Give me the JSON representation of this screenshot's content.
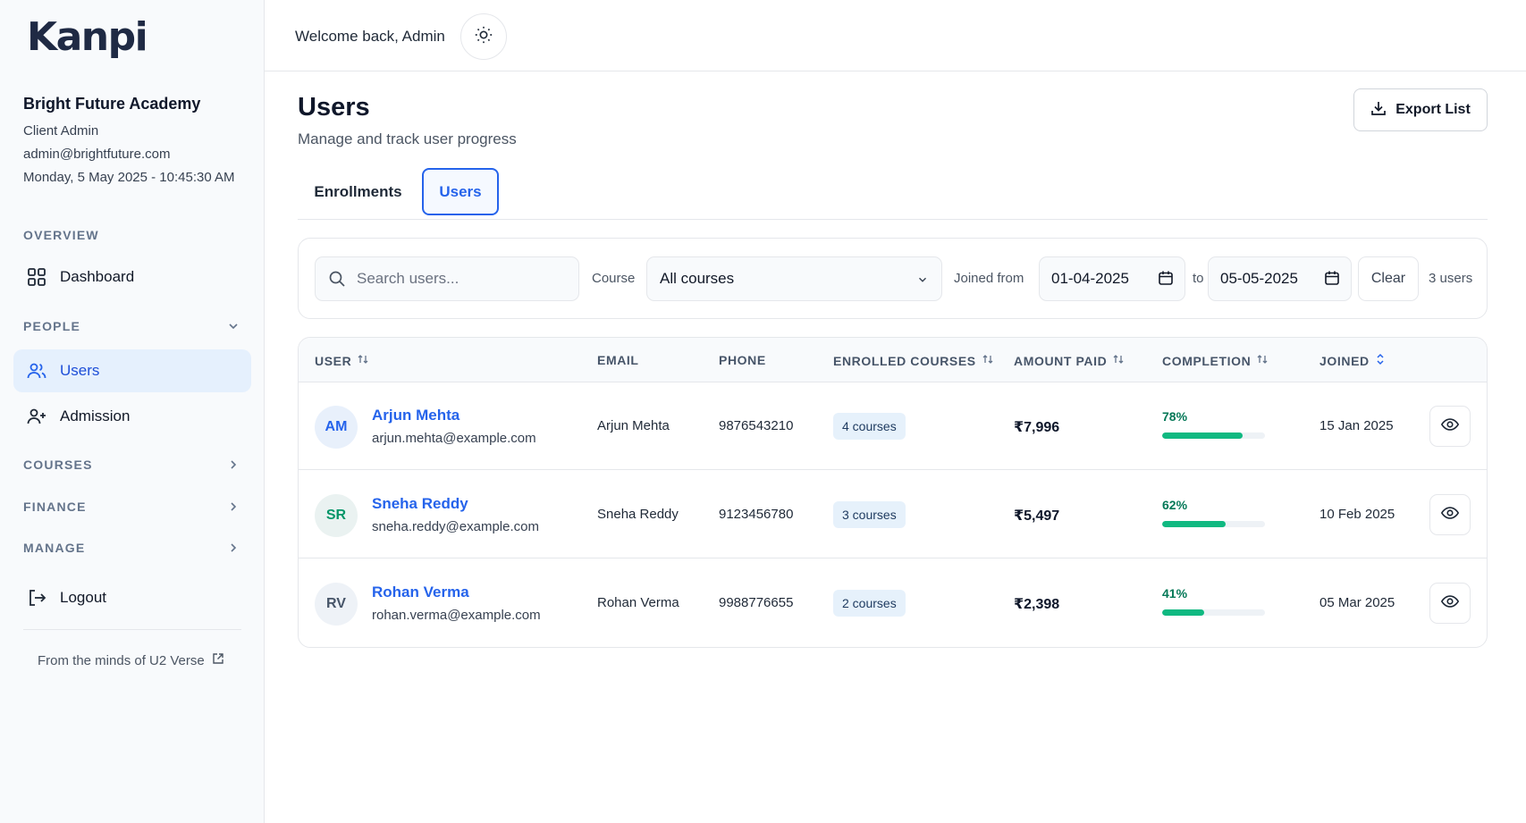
{
  "brand": {
    "logo_text": "Kanpi"
  },
  "org": {
    "name": "Bright Future Academy",
    "role": "Client Admin",
    "email": "admin@brightfuture.com",
    "datetime": "Monday, 5 May 2025 - 10:45:30 AM"
  },
  "sidebar": {
    "overview_label": "OVERVIEW",
    "dashboard_label": "Dashboard",
    "people_label": "PEOPLE",
    "users_label": "Users",
    "admission_label": "Admission",
    "courses_label": "COURSES",
    "finance_label": "FINANCE",
    "manage_label": "MANAGE",
    "logout_label": "Logout",
    "credit": "From the minds of U2 Verse"
  },
  "header": {
    "welcome": "Welcome back, Admin"
  },
  "page": {
    "title": "Users",
    "subtitle": "Manage and track user progress",
    "export_label": "Export List"
  },
  "tabs": [
    {
      "label": "Enrollments",
      "active": false
    },
    {
      "label": "Users",
      "active": true
    }
  ],
  "filters": {
    "search_placeholder": "Search users...",
    "course_label": "Course",
    "course_value": "All courses",
    "joined_from_label": "Joined from",
    "date_from": "01-04-2025",
    "to_label": "to",
    "date_to": "05-05-2025",
    "clear_label": "Clear",
    "count": "3 users"
  },
  "table": {
    "headers": {
      "user": "USER",
      "email": "EMAIL",
      "phone": "PHONE",
      "courses": "ENROLLED COURSES",
      "amount": "AMOUNT PAID",
      "completion": "COMPLETION",
      "joined": "JOINED"
    },
    "rows": [
      {
        "initials": "AM",
        "initials_color": "#2563eb",
        "name": "Arjun Mehta",
        "email": "arjun.mehta@example.com",
        "display_name": "Arjun Mehta",
        "phone": "9876543210",
        "courses": "4 courses",
        "amount": "₹7,996",
        "completion": "78%",
        "completion_value": 78,
        "joined": "15 Jan 2025"
      },
      {
        "initials": "SR",
        "initials_color": "#059669",
        "name": "Sneha Reddy",
        "email": "sneha.reddy@example.com",
        "display_name": "Sneha Reddy",
        "phone": "9123456780",
        "courses": "3 courses",
        "amount": "₹5,497",
        "completion": "62%",
        "completion_value": 62,
        "joined": "10 Feb 2025"
      },
      {
        "initials": "RV",
        "initials_color": "#475569",
        "name": "Rohan Verma",
        "email": "rohan.verma@example.com",
        "display_name": "Rohan Verma",
        "phone": "9988776655",
        "courses": "2 courses",
        "amount": "₹2,398",
        "completion": "41%",
        "completion_value": 41,
        "joined": "05 Mar 2025"
      }
    ]
  },
  "colors": {
    "accent": "#2563eb",
    "progress": "#10b981",
    "active_nav_bg": "#e5f0fd"
  }
}
